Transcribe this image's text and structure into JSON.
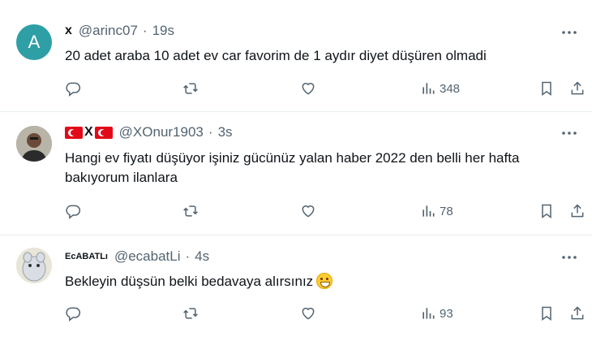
{
  "tweets": [
    {
      "avatar_letter": "A",
      "display_name": "x",
      "handle": "@arinc07",
      "separator": "·",
      "time": "19s",
      "text": "20 adet araba 10 adet ev car favorim de 1 aydır diyet düşüren olmadi",
      "views": "348",
      "avatar_color": "#2f9fa6"
    },
    {
      "display_name": "X",
      "handle": "@XOnur1903",
      "separator": "·",
      "time": "3s",
      "text_line1": "Hangi ev fiyatı düşüyor işiniz gücünüz yalan haber 2022 den belli her hafta",
      "text_line2": "bakıyorum ilanlara",
      "views": "78"
    },
    {
      "display_name": "EcABATLı",
      "handle": "@ecabatLi",
      "separator": "·",
      "time": "4s",
      "text": "Bekleyin düşsün belki bedavaya alırsınız",
      "views": "93"
    }
  ],
  "icons": {
    "reply": "reply-icon",
    "retweet": "retweet-icon",
    "like": "heart-icon",
    "views": "views-icon",
    "bookmark": "bookmark-icon",
    "share": "share-icon",
    "more": "more-icon"
  },
  "colors": {
    "icon_gray": "#536471",
    "divider": "#e6ecf0",
    "flag_red": "#e30a17"
  }
}
